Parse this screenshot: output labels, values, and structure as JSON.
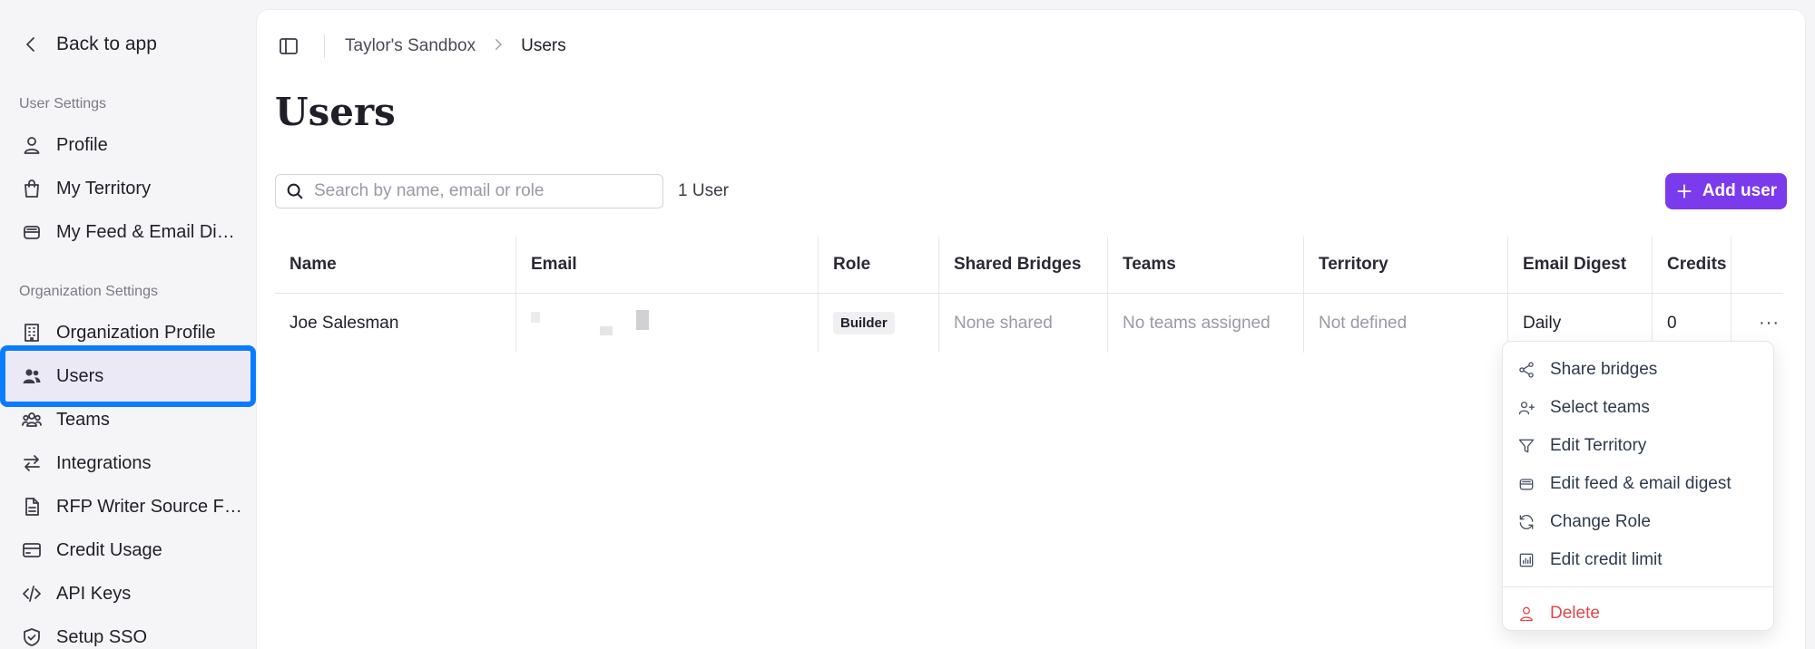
{
  "sidebar": {
    "back_label": "Back to app",
    "user_settings_label": "User Settings",
    "user_items": [
      {
        "label": "Profile",
        "icon": "person-icon"
      },
      {
        "label": "My Territory",
        "icon": "bag-icon"
      },
      {
        "label": "My Feed & Email Digest",
        "icon": "inbox-icon"
      }
    ],
    "org_settings_label": "Organization Settings",
    "org_items": [
      {
        "label": "Organization Profile",
        "icon": "building-icon"
      },
      {
        "label": "Users",
        "icon": "users-icon"
      },
      {
        "label": "Teams",
        "icon": "team-icon"
      },
      {
        "label": "Integrations",
        "icon": "arrows-exchange-icon"
      },
      {
        "label": "RFP Writer Source Files",
        "icon": "file-icon"
      },
      {
        "label": "Credit Usage",
        "icon": "credit-card-icon"
      },
      {
        "label": "API Keys",
        "icon": "code-icon"
      },
      {
        "label": "Setup SSO",
        "icon": "shield-check-icon"
      }
    ]
  },
  "breadcrumb": {
    "workspace": "Taylor's Sandbox",
    "current": "Users"
  },
  "page": {
    "title": "Users"
  },
  "search": {
    "placeholder": "Search by name, email or role",
    "value": ""
  },
  "user_count": "1 User",
  "add_user_label": "Add user",
  "table": {
    "columns": [
      "Name",
      "Email",
      "Role",
      "Shared Bridges",
      "Teams",
      "Territory",
      "Email Digest",
      "Credits"
    ],
    "rows": [
      {
        "name": "Joe Salesman",
        "email": "",
        "role": "Builder",
        "shared_bridges": "None shared",
        "teams": "No teams assigned",
        "territory": "Not defined",
        "email_digest": "Daily",
        "credits": "0",
        "more": "···"
      }
    ]
  },
  "row_menu": {
    "items": [
      {
        "label": "Share bridges",
        "icon": "share-icon"
      },
      {
        "label": "Select teams",
        "icon": "user-plus-icon"
      },
      {
        "label": "Edit Territory",
        "icon": "filter-icon"
      },
      {
        "label": "Edit feed & email digest",
        "icon": "inbox-icon"
      },
      {
        "label": "Change Role",
        "icon": "refresh-icon"
      },
      {
        "label": "Edit credit limit",
        "icon": "chart-icon"
      }
    ],
    "delete_label": "Delete"
  },
  "colors": {
    "accent": "#7c3aed",
    "highlight_outline": "#0a7cff",
    "danger": "#e0474c"
  }
}
